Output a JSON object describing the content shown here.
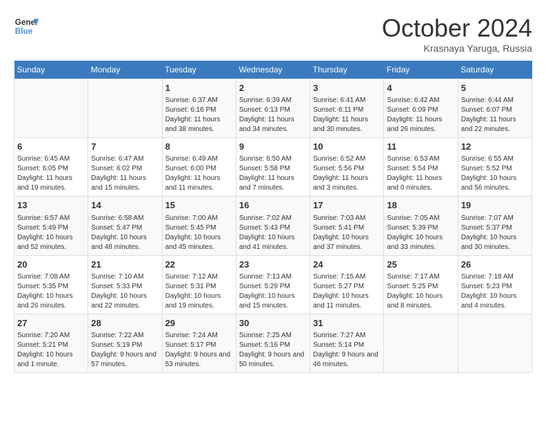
{
  "header": {
    "logo_line1": "General",
    "logo_line2": "Blue",
    "month": "October 2024",
    "location": "Krasnaya Yaruga, Russia"
  },
  "days_of_week": [
    "Sunday",
    "Monday",
    "Tuesday",
    "Wednesday",
    "Thursday",
    "Friday",
    "Saturday"
  ],
  "weeks": [
    [
      {
        "day": "",
        "info": ""
      },
      {
        "day": "",
        "info": ""
      },
      {
        "day": "1",
        "sunrise": "6:37 AM",
        "sunset": "6:16 PM",
        "daylight": "11 hours and 38 minutes."
      },
      {
        "day": "2",
        "sunrise": "6:39 AM",
        "sunset": "6:13 PM",
        "daylight": "11 hours and 34 minutes."
      },
      {
        "day": "3",
        "sunrise": "6:41 AM",
        "sunset": "6:11 PM",
        "daylight": "11 hours and 30 minutes."
      },
      {
        "day": "4",
        "sunrise": "6:42 AM",
        "sunset": "6:09 PM",
        "daylight": "11 hours and 26 minutes."
      },
      {
        "day": "5",
        "sunrise": "6:44 AM",
        "sunset": "6:07 PM",
        "daylight": "11 hours and 22 minutes."
      }
    ],
    [
      {
        "day": "6",
        "sunrise": "6:45 AM",
        "sunset": "6:05 PM",
        "daylight": "11 hours and 19 minutes."
      },
      {
        "day": "7",
        "sunrise": "6:47 AM",
        "sunset": "6:02 PM",
        "daylight": "11 hours and 15 minutes."
      },
      {
        "day": "8",
        "sunrise": "6:49 AM",
        "sunset": "6:00 PM",
        "daylight": "11 hours and 11 minutes."
      },
      {
        "day": "9",
        "sunrise": "6:50 AM",
        "sunset": "5:58 PM",
        "daylight": "11 hours and 7 minutes."
      },
      {
        "day": "10",
        "sunrise": "6:52 AM",
        "sunset": "5:56 PM",
        "daylight": "11 hours and 3 minutes."
      },
      {
        "day": "11",
        "sunrise": "6:53 AM",
        "sunset": "5:54 PM",
        "daylight": "11 hours and 0 minutes."
      },
      {
        "day": "12",
        "sunrise": "6:55 AM",
        "sunset": "5:52 PM",
        "daylight": "10 hours and 56 minutes."
      }
    ],
    [
      {
        "day": "13",
        "sunrise": "6:57 AM",
        "sunset": "5:49 PM",
        "daylight": "10 hours and 52 minutes."
      },
      {
        "day": "14",
        "sunrise": "6:58 AM",
        "sunset": "5:47 PM",
        "daylight": "10 hours and 48 minutes."
      },
      {
        "day": "15",
        "sunrise": "7:00 AM",
        "sunset": "5:45 PM",
        "daylight": "10 hours and 45 minutes."
      },
      {
        "day": "16",
        "sunrise": "7:02 AM",
        "sunset": "5:43 PM",
        "daylight": "10 hours and 41 minutes."
      },
      {
        "day": "17",
        "sunrise": "7:03 AM",
        "sunset": "5:41 PM",
        "daylight": "10 hours and 37 minutes."
      },
      {
        "day": "18",
        "sunrise": "7:05 AM",
        "sunset": "5:39 PM",
        "daylight": "10 hours and 33 minutes."
      },
      {
        "day": "19",
        "sunrise": "7:07 AM",
        "sunset": "5:37 PM",
        "daylight": "10 hours and 30 minutes."
      }
    ],
    [
      {
        "day": "20",
        "sunrise": "7:08 AM",
        "sunset": "5:35 PM",
        "daylight": "10 hours and 26 minutes."
      },
      {
        "day": "21",
        "sunrise": "7:10 AM",
        "sunset": "5:33 PM",
        "daylight": "10 hours and 22 minutes."
      },
      {
        "day": "22",
        "sunrise": "7:12 AM",
        "sunset": "5:31 PM",
        "daylight": "10 hours and 19 minutes."
      },
      {
        "day": "23",
        "sunrise": "7:13 AM",
        "sunset": "5:29 PM",
        "daylight": "10 hours and 15 minutes."
      },
      {
        "day": "24",
        "sunrise": "7:15 AM",
        "sunset": "5:27 PM",
        "daylight": "10 hours and 11 minutes."
      },
      {
        "day": "25",
        "sunrise": "7:17 AM",
        "sunset": "5:25 PM",
        "daylight": "10 hours and 8 minutes."
      },
      {
        "day": "26",
        "sunrise": "7:18 AM",
        "sunset": "5:23 PM",
        "daylight": "10 hours and 4 minutes."
      }
    ],
    [
      {
        "day": "27",
        "sunrise": "7:20 AM",
        "sunset": "5:21 PM",
        "daylight": "10 hours and 1 minute."
      },
      {
        "day": "28",
        "sunrise": "7:22 AM",
        "sunset": "5:19 PM",
        "daylight": "9 hours and 57 minutes."
      },
      {
        "day": "29",
        "sunrise": "7:24 AM",
        "sunset": "5:17 PM",
        "daylight": "9 hours and 53 minutes."
      },
      {
        "day": "30",
        "sunrise": "7:25 AM",
        "sunset": "5:16 PM",
        "daylight": "9 hours and 50 minutes."
      },
      {
        "day": "31",
        "sunrise": "7:27 AM",
        "sunset": "5:14 PM",
        "daylight": "9 hours and 46 minutes."
      },
      {
        "day": "",
        "info": ""
      },
      {
        "day": "",
        "info": ""
      }
    ]
  ],
  "labels": {
    "sunrise": "Sunrise:",
    "sunset": "Sunset:",
    "daylight": "Daylight:"
  }
}
